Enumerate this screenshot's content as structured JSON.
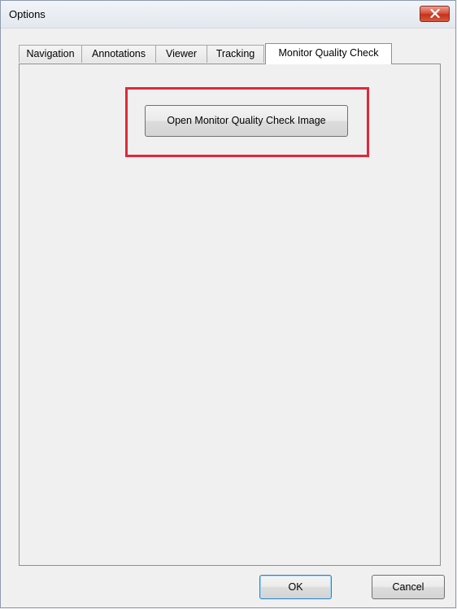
{
  "window": {
    "title": "Options"
  },
  "tabs": [
    {
      "label": "Navigation",
      "active": false
    },
    {
      "label": "Annotations",
      "active": false
    },
    {
      "label": "Viewer",
      "active": false
    },
    {
      "label": "Tracking",
      "active": false
    },
    {
      "label": "Monitor Quality Check",
      "active": true
    }
  ],
  "panel": {
    "open_image_button_label": "Open Monitor Quality Check Image",
    "highlight_color": "#e0283a"
  },
  "footer": {
    "ok_label": "OK",
    "cancel_label": "Cancel"
  },
  "icons": {
    "close": "close-icon"
  }
}
